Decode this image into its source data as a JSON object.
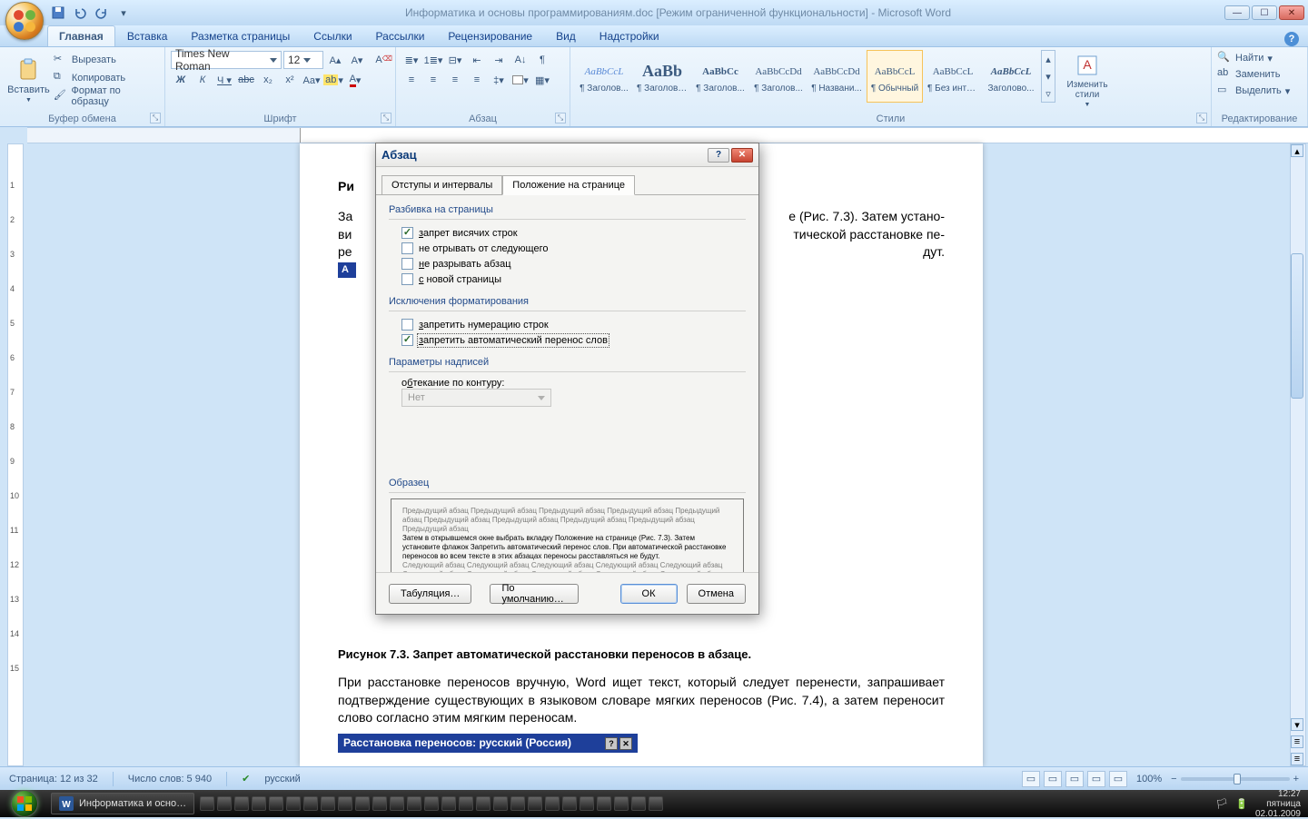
{
  "title": "Информатика и основы программированиям.doc [Режим ограниченной функциональности] - Microsoft Word",
  "ribbon_tabs": [
    "Главная",
    "Вставка",
    "Разметка страницы",
    "Ссылки",
    "Рассылки",
    "Рецензирование",
    "Вид",
    "Надстройки"
  ],
  "active_tab_index": 0,
  "clipboard": {
    "paste": "Вставить",
    "cut": "Вырезать",
    "copy": "Копировать",
    "format_painter": "Формат по образцу",
    "group": "Буфер обмена"
  },
  "font": {
    "name": "Times New Roman",
    "size": "12",
    "group": "Шрифт"
  },
  "para": {
    "group": "Абзац"
  },
  "styles": {
    "group": "Стили",
    "change": "Изменить стили",
    "items": [
      {
        "preview": "AaBbCcL",
        "label": "¶ Заголов..."
      },
      {
        "preview": "AaBb",
        "label": "¶ Заголово..."
      },
      {
        "preview": "AaBbCc",
        "label": "¶ Заголов..."
      },
      {
        "preview": "AaBbCcDd",
        "label": "¶ Заголов..."
      },
      {
        "preview": "AaBbCcDd",
        "label": "¶ Названи..."
      },
      {
        "preview": "AaBbCcL",
        "label": "¶ Обычный"
      },
      {
        "preview": "AaBbCcL",
        "label": "¶ Без инте..."
      },
      {
        "preview": "AaBbCcL",
        "label": "Заголово..."
      }
    ],
    "selected_index": 5
  },
  "editing": {
    "group": "Редактирование",
    "find": "Найти",
    "replace": "Заменить",
    "select": "Выделить"
  },
  "doc": {
    "fig_ri": "Ри",
    "line1_a": "За",
    "line1_b": "е (Рис. 7.3). Затем устано-",
    "line2_a": "ви",
    "line2_b": "тической расстановке пе-",
    "line3_a": "ре",
    "line3_b": "дут.",
    "fig_caption": "Рисунок 7.3. Запрет автоматической расстановки переносов в абзаце.",
    "para2": "При расстановке переносов вручную, Word ищет текст, который следует перенести, запрашивает подтверждение существующих в языковом словаре мягких переносов (Рис. 7.4), а затем переносит слово согласно этим мягким переносам.",
    "bluebar_title": "Расстановка переносов: русский (Россия)"
  },
  "dialog": {
    "title": "Абзац",
    "tab1": "Отступы и интервалы",
    "tab2": "Положение на странице",
    "grp_pagination": "Разбивка на страницы",
    "chk_widow": "запрет висячих строк",
    "chk_keep_next": "не отрывать от следующего",
    "chk_keep_together": "не разрывать абзац",
    "chk_page_before": "с новой страницы",
    "grp_format_exc": "Исключения форматирования",
    "chk_suppress_ln": "запретить нумерацию строк",
    "chk_no_hyphen": "запретить автоматический перенос слов",
    "grp_textbox": "Параметры надписей",
    "wrap_label": "обтекание по контуру:",
    "wrap_value": "Нет",
    "grp_preview": "Образец",
    "preview_grey": "Предыдущий абзац Предыдущий абзац Предыдущий абзац Предыдущий абзац Предыдущий абзац Предыдущий абзац Предыдущий абзац Предыдущий абзац Предыдущий абзац Предыдущий абзац",
    "preview_strong": "Затем в открывшемся окне выбрать вкладку Положение на странице (Рис. 7.3). Затем установите флажок Запретить автоматический перенос слов. При автоматической расстановке переносов во всем тексте в этих абзацах переносы расставляться не будут.",
    "preview_grey2": "Следующий абзац Следующий абзац Следующий абзац Следующий абзац Следующий абзац Следующий абзац Следующий абзац Следующий абзац Следующий абзац Следующий абзац Следующий абзац Следующий абзац Следующий абзац",
    "btn_tabs": "Табуляция…",
    "btn_default": "По умолчанию…",
    "btn_ok": "ОК",
    "btn_cancel": "Отмена"
  },
  "status": {
    "page": "Страница: 12 из 32",
    "words": "Число слов: 5 940",
    "lang": "русский",
    "zoom": "100%"
  },
  "taskbar": {
    "app": "Информатика и осно…",
    "time": "12:27",
    "day": "пятница",
    "date": "02.01.2009"
  }
}
